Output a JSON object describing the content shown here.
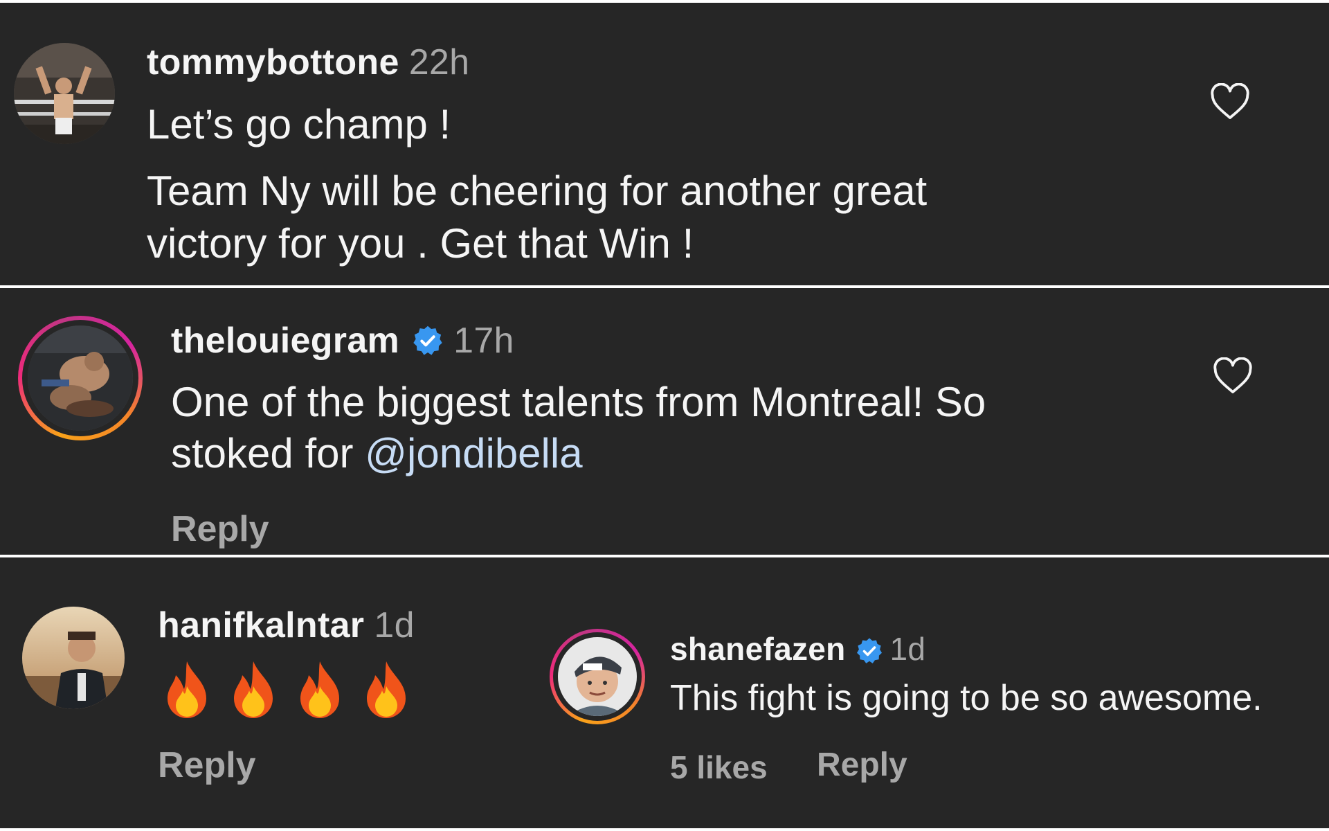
{
  "comments": [
    {
      "username": "tommybottone",
      "time": "22h",
      "line1": "Let’s go champ !",
      "line2": "Team Ny will be cheering for another great",
      "line3": "victory for you . Get that Win !",
      "avatar_icon": "boxer-photo-avatar",
      "like_icon": "heart-outline-icon"
    },
    {
      "username": "thelouiegram",
      "verified": true,
      "time": "17h",
      "line1": "One of the biggest talents from Montreal! So",
      "line2_prefix": "stoked for ",
      "mention": "@jondibella",
      "reply_label": "Reply",
      "avatar_icon": "fighter-photo-avatar",
      "like_icon": "heart-outline-icon"
    },
    {
      "username": "hanifkalntar",
      "time": "1d",
      "emoji": "🔥🔥🔥🔥",
      "reply_label": "Reply",
      "avatar_icon": "profile-photo-avatar"
    },
    {
      "username": "shanefazen",
      "verified": true,
      "time": "1d",
      "text": "This fight is going to be so awesome.",
      "likes": "5 likes",
      "reply_label": "Reply",
      "avatar_icon": "cap-profile-photo-avatar"
    }
  ],
  "colors": {
    "background": "#262626",
    "primary_text": "#f5f5f5",
    "secondary_text": "#a8a8a8",
    "verified_blue": "#3897f0",
    "mention": "#c7dcf5"
  }
}
